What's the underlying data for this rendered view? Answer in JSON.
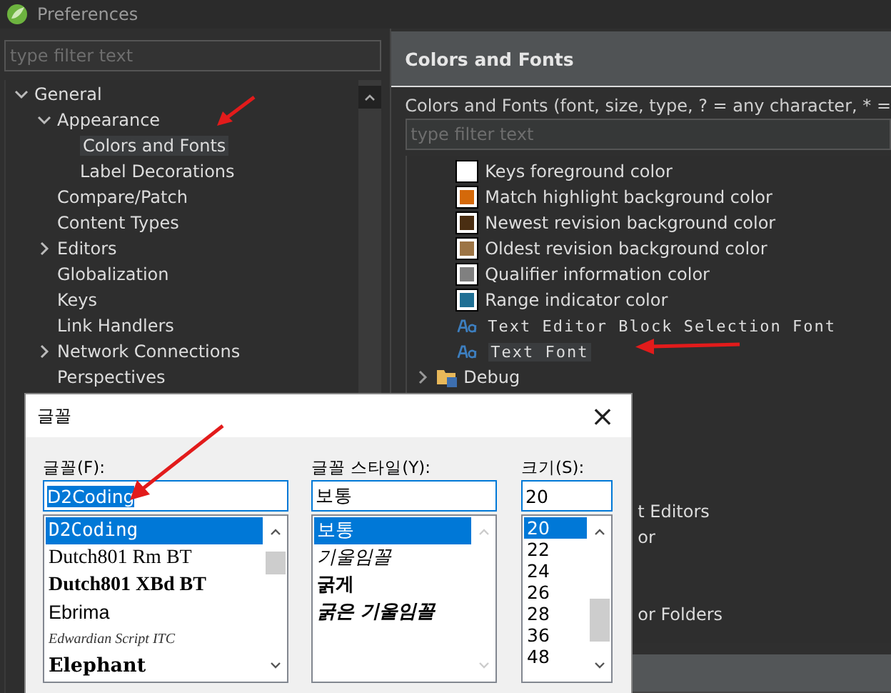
{
  "window": {
    "title": "Preferences"
  },
  "left": {
    "filter": {
      "placeholder": "type filter text"
    },
    "tree": [
      {
        "label": "General",
        "expanded": true,
        "selected": false,
        "children": [
          {
            "label": "Appearance",
            "expanded": true,
            "selected": false,
            "children": [
              {
                "label": "Colors and Fonts",
                "selected": true
              },
              {
                "label": "Label Decorations",
                "selected": false
              }
            ]
          },
          {
            "label": "Compare/Patch",
            "selected": false
          },
          {
            "label": "Content Types",
            "selected": false
          },
          {
            "label": "Editors",
            "expanded": false,
            "selected": false
          },
          {
            "label": "Globalization",
            "selected": false
          },
          {
            "label": "Keys",
            "selected": false
          },
          {
            "label": "Link Handlers",
            "selected": false
          },
          {
            "label": "Network Connections",
            "expanded": false,
            "selected": false
          },
          {
            "label": "Perspectives",
            "selected": false
          }
        ]
      }
    ]
  },
  "right": {
    "title": "Colors and Fonts",
    "description": "Colors and Fonts (font, size, type, ? = any character, * =",
    "filter": {
      "placeholder": "type filter text"
    },
    "items": [
      {
        "kind": "color",
        "label": "Keys foreground color",
        "color": "#ffffff",
        "selected": false
      },
      {
        "kind": "color",
        "label": "Match highlight background color",
        "color": "#d4690a",
        "selected": false
      },
      {
        "kind": "color",
        "label": "Newest revision background color",
        "color": "#4a2e12",
        "selected": false
      },
      {
        "kind": "color",
        "label": "Oldest revision background color",
        "color": "#9c7445",
        "selected": false
      },
      {
        "kind": "color",
        "label": "Qualifier information color",
        "color": "#808080",
        "selected": false
      },
      {
        "kind": "color",
        "label": "Range indicator color",
        "color": "#1f6f94",
        "selected": false
      },
      {
        "kind": "font",
        "label": "Text Editor Block Selection Font",
        "selected": false
      },
      {
        "kind": "font",
        "label": "Text Font",
        "selected": true
      },
      {
        "kind": "category",
        "label": "Debug",
        "expanded": false,
        "selected": false
      }
    ],
    "fragments": [
      "t Editors",
      "or",
      "or Folders"
    ]
  },
  "font_dialog": {
    "title": "글꼴",
    "close": "×",
    "font": {
      "label": "글꼴(F):",
      "value": "D2Coding",
      "items": [
        {
          "label": "D2Coding",
          "kind": "mono",
          "selected": true
        },
        {
          "label": "Dutch801 Rm BT",
          "kind": "serif",
          "selected": false
        },
        {
          "label": "Dutch801 XBd BT",
          "kind": "serif-bold",
          "selected": false
        },
        {
          "label": "Ebrima",
          "kind": "sans",
          "selected": false
        },
        {
          "label": "Edwardian Script ITC",
          "kind": "script",
          "selected": false
        },
        {
          "label": "Elephant",
          "kind": "display",
          "selected": false
        }
      ]
    },
    "style": {
      "label": "글꼴 스타일(Y):",
      "value": "보통",
      "items": [
        {
          "label": "보통",
          "kind": "regular",
          "selected": true
        },
        {
          "label": "기울임꼴",
          "kind": "italic",
          "selected": false
        },
        {
          "label": "굵게",
          "kind": "bold",
          "selected": false
        },
        {
          "label": "굵은 기울임꼴",
          "kind": "bold-italic",
          "selected": false
        }
      ]
    },
    "size": {
      "label": "크기(S):",
      "value": "20",
      "items": [
        {
          "label": "20",
          "selected": true
        },
        {
          "label": "22",
          "selected": false
        },
        {
          "label": "24",
          "selected": false
        },
        {
          "label": "26",
          "selected": false
        },
        {
          "label": "28",
          "selected": false
        },
        {
          "label": "36",
          "selected": false
        },
        {
          "label": "48",
          "selected": false
        }
      ]
    }
  }
}
